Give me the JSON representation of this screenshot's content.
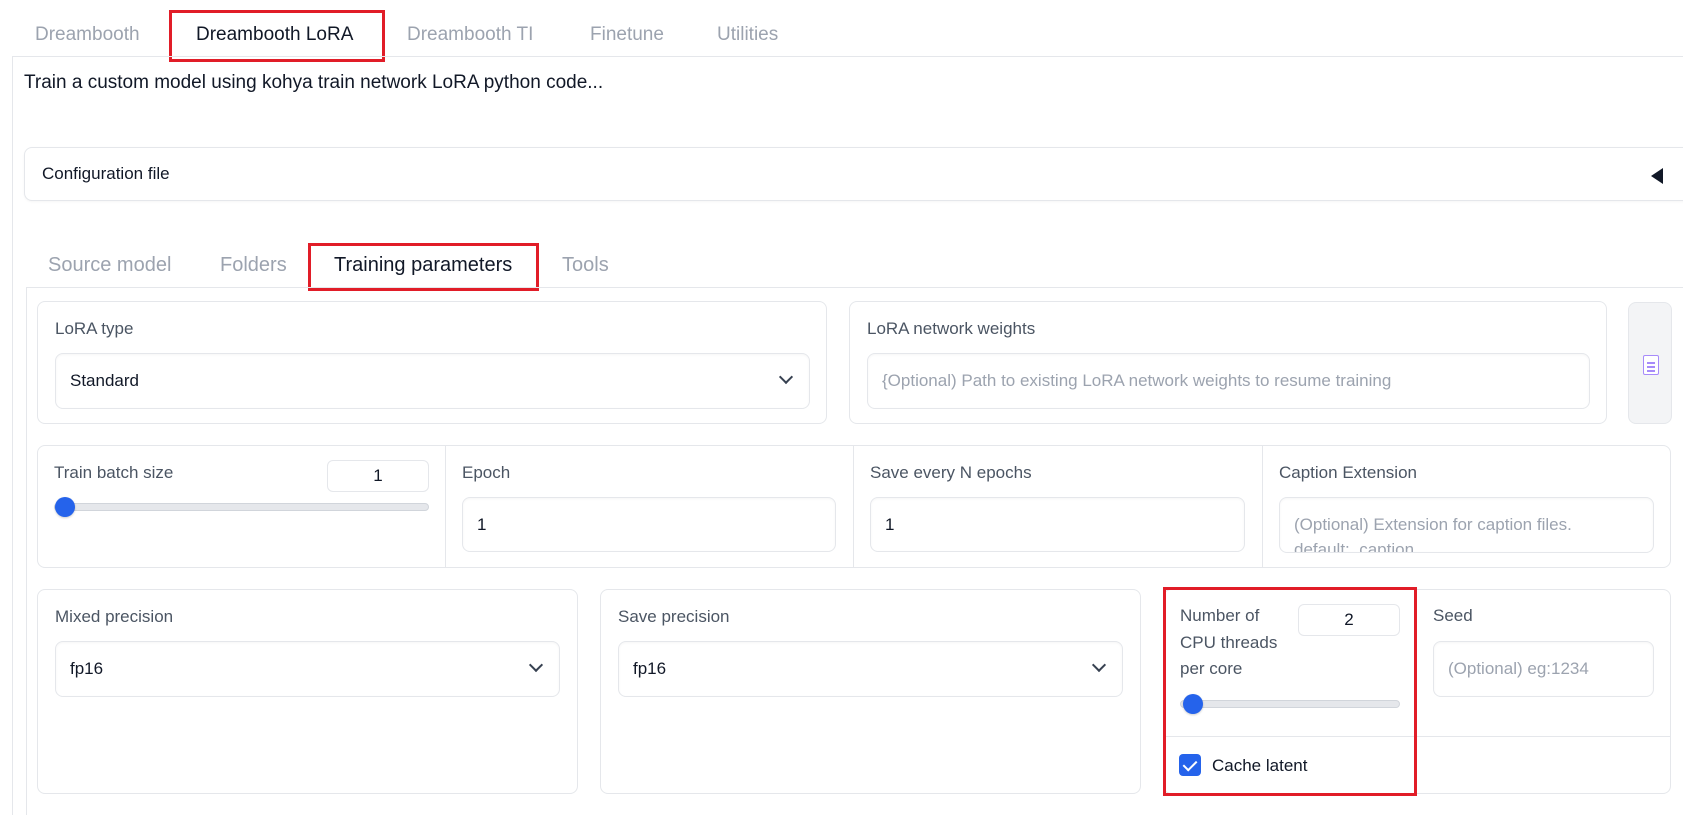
{
  "top_tabs": [
    "Dreambooth",
    "Dreambooth LoRA",
    "Dreambooth TI",
    "Finetune",
    "Utilities"
  ],
  "description": "Train a custom model using kohya train network LoRA python code...",
  "config_accordion_label": "Configuration file",
  "sub_tabs": [
    "Source model",
    "Folders",
    "Training parameters",
    "Tools"
  ],
  "lora_type": {
    "label": "LoRA type",
    "value": "Standard"
  },
  "network_weights": {
    "label": "LoRA network weights",
    "placeholder": "{Optional) Path to existing LoRA network weights to resume training"
  },
  "train_batch_size": {
    "label": "Train batch size",
    "value": "1",
    "slider_fraction": 0.0
  },
  "epoch": {
    "label": "Epoch",
    "value": "1"
  },
  "save_every": {
    "label": "Save every N epochs",
    "value": "1"
  },
  "caption_extension": {
    "label": "Caption Extension",
    "placeholder_line1": "(Optional) Extension for caption files.",
    "placeholder_line2": "default: .caption"
  },
  "mixed_precision": {
    "label": "Mixed precision",
    "value": "fp16"
  },
  "save_precision": {
    "label": "Save precision",
    "value": "fp16"
  },
  "cpu_threads": {
    "label_line1": "Number of",
    "label_line2": "CPU threads",
    "label_line3": "per core",
    "value": "2",
    "slider_fraction": 0.05
  },
  "seed": {
    "label": "Seed",
    "placeholder": "(Optional) eg:1234"
  },
  "cache_latent": {
    "label": "Cache latent",
    "checked": true
  },
  "colors": {
    "accent": "#2563eb",
    "highlight": "#e11d28"
  },
  "icons": {
    "file": "file-icon",
    "accordion": "caret-left-icon",
    "dropdown": "chevron-down-icon"
  }
}
